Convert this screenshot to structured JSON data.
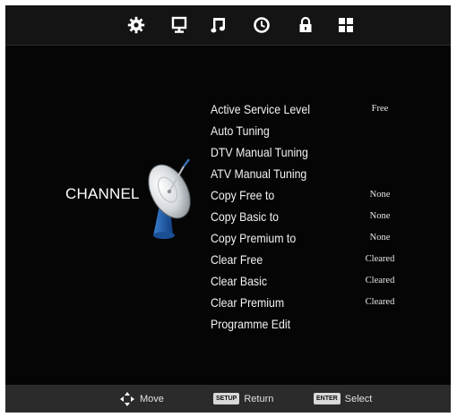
{
  "top_menu": {
    "icons": [
      "gear-icon",
      "monitor-icon",
      "music-note-icon",
      "clock-icon",
      "lock-icon",
      "grid-icon"
    ]
  },
  "section_title": "CHANNEL",
  "menu": {
    "items": [
      {
        "label": "Active Service Level",
        "value": "Free"
      },
      {
        "label": "Auto Tuning",
        "value": ""
      },
      {
        "label": "DTV Manual Tuning",
        "value": ""
      },
      {
        "label": "ATV Manual Tuning",
        "value": ""
      },
      {
        "label": "Copy Free to",
        "value": "None"
      },
      {
        "label": "Copy Basic to",
        "value": "None"
      },
      {
        "label": "Copy Premium to",
        "value": "None"
      },
      {
        "label": "Clear Free",
        "value": "Cleared"
      },
      {
        "label": "Clear Basic",
        "value": "Cleared"
      },
      {
        "label": "Clear Premium",
        "value": "Cleared"
      },
      {
        "label": "Programme Edit",
        "value": ""
      }
    ]
  },
  "hints": {
    "move": "Move",
    "return_key": "SETUP",
    "return": "Return",
    "select_key": "ENTER",
    "select": "Select"
  },
  "colors": {
    "background": "#050505",
    "topbar": "#141414",
    "bottombar": "#2b2b2b",
    "text": "#ffffff",
    "dish_stand": "#1e5fa8"
  }
}
